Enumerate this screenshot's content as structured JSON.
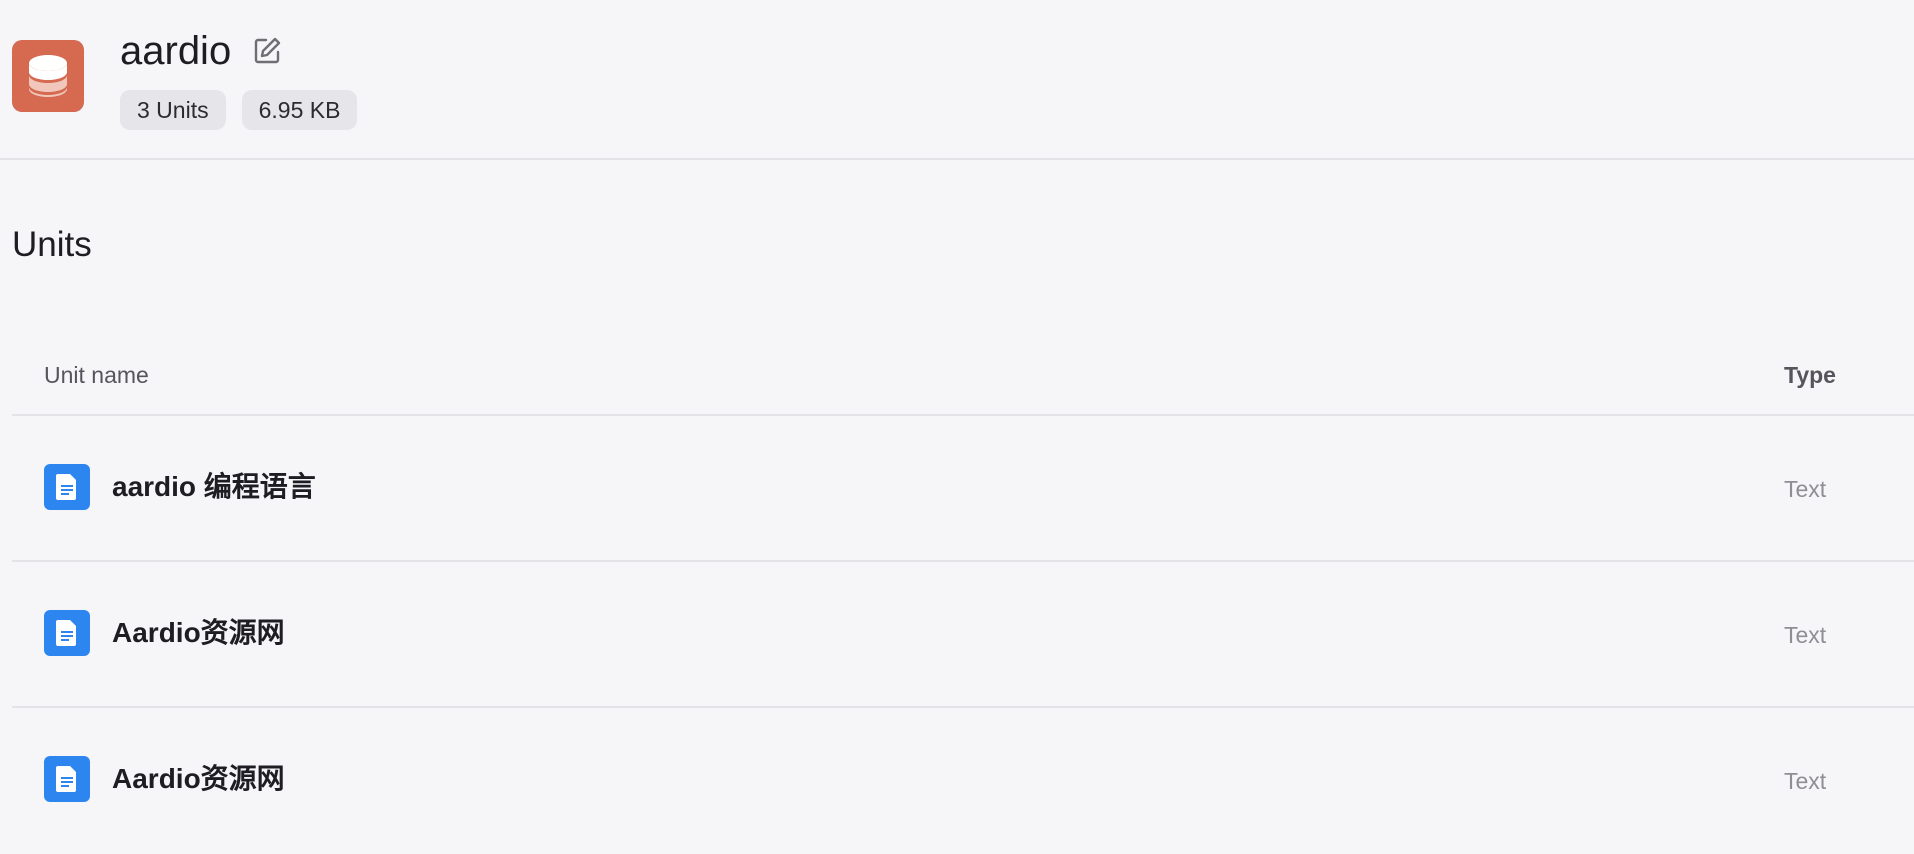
{
  "knowledge_base": {
    "title": "aardio",
    "badges": [
      "3 Units",
      "6.95 KB"
    ]
  },
  "section": {
    "title": "Units"
  },
  "table": {
    "columns": {
      "name": "Unit name",
      "type": "Type"
    },
    "rows": [
      {
        "name": "aardio 编程语言",
        "type": "Text"
      },
      {
        "name": "Aardio资源网",
        "type": "Text"
      },
      {
        "name": "Aardio资源网",
        "type": "Text"
      }
    ]
  },
  "icons": {
    "kb": "database-icon",
    "edit": "edit-icon",
    "row": "document-icon"
  },
  "colors": {
    "accent": "#d66a51",
    "doc_icon": "#2d86f0",
    "background": "#f6f6f9"
  }
}
